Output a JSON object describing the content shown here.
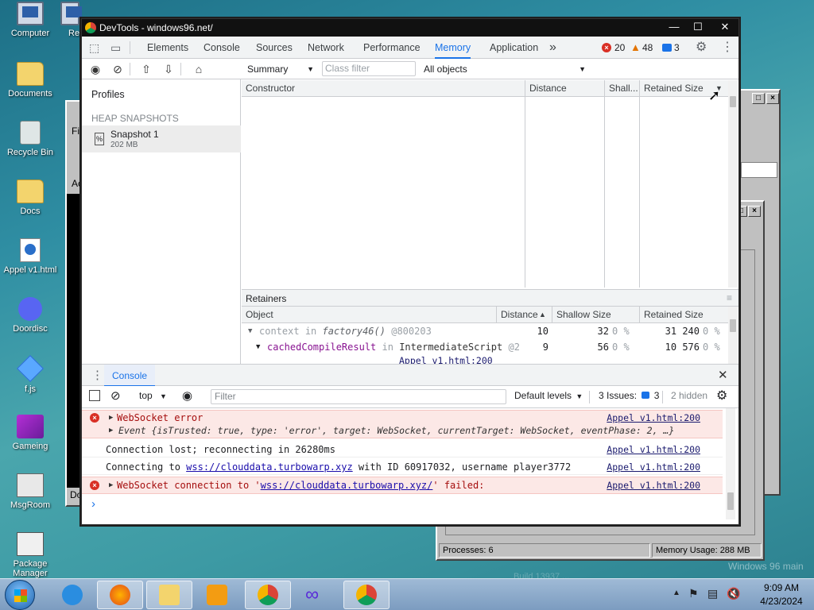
{
  "desktop": {
    "icons": [
      {
        "label": "Computer",
        "icon": "computer-icon"
      },
      {
        "label": "Re",
        "icon": "computer-icon"
      },
      {
        "label": "Documents",
        "icon": "folder-icon"
      },
      {
        "label": "Recycle Bin",
        "icon": "recycle-bin-icon"
      },
      {
        "label": "Docs",
        "icon": "folder-icon"
      },
      {
        "label": "Appel v1.html",
        "icon": "html-file-icon"
      },
      {
        "label": "Doordisc",
        "icon": "discord-icon"
      },
      {
        "label": "f.js",
        "icon": "diamond-icon"
      },
      {
        "label": "Gameing",
        "icon": "cube-icon"
      },
      {
        "label": "MsgRoom",
        "icon": "msgroom-icon"
      },
      {
        "label": "Package Manager",
        "icon": "package-icon"
      }
    ],
    "watermark": "Windows 96 main",
    "build_text": "Build 13937 ..."
  },
  "background_window": {
    "processes": "Processes: 6",
    "memory_usage": "Memory Usage: 288 MB",
    "fragments": [
      "Fi",
      "Ac",
      "Do"
    ]
  },
  "devtools": {
    "title": "DevTools - windows96.net/",
    "tabs": [
      {
        "label": "Elements"
      },
      {
        "label": "Console"
      },
      {
        "label": "Sources"
      },
      {
        "label": "Network"
      },
      {
        "label": "Performance"
      },
      {
        "label": "Memory"
      },
      {
        "label": "Application"
      }
    ],
    "more_tabs": "»",
    "error_count": "20",
    "warning_count": "48",
    "info_count": "3",
    "profiles_label": "Profiles",
    "heap_snapshots_label": "HEAP SNAPSHOTS",
    "snapshot": {
      "name": "Snapshot 1",
      "size": "202 MB"
    },
    "summary_select": "Summary",
    "class_filter_placeholder": "Class filter",
    "objects_select": "All objects",
    "columns": {
      "constructor": "Constructor",
      "distance": "Distance",
      "shallow": "Shall...",
      "retained": "Retained Size"
    },
    "retainers": {
      "title": "Retainers",
      "columns": {
        "object": "Object",
        "distance": "Distance",
        "shallow": "Shallow Size",
        "retained": "Retained Size"
      },
      "rows": [
        {
          "object_key": "context",
          "object_in": "in",
          "object_fn": "factory46()",
          "object_id": "@800203",
          "distance": "10",
          "shallow": "32",
          "shallow_pct": "0 %",
          "retained": "31 240",
          "retained_pct": "0 %"
        },
        {
          "object_key": "cachedCompileResult",
          "object_in": "in",
          "object_fn": "IntermediateScript",
          "object_id": "@2",
          "distance": "9",
          "shallow": "56",
          "shallow_pct": "0 %",
          "retained": "10 576",
          "retained_pct": "0 %"
        }
      ],
      "partial_link": "Appel v1.html:200"
    },
    "console": {
      "drawer_tab": "Console",
      "context": "top",
      "filter_placeholder": "Filter",
      "levels": "Default levels",
      "issues_label": "3 Issues:",
      "issues_count": "3",
      "hidden": "2 hidden",
      "messages": [
        {
          "type": "error",
          "text": "WebSocket error",
          "source": "Appel v1.html:200"
        },
        {
          "type": "error-detail",
          "text": "Event {isTrusted: true, type: 'error', target: WebSocket, currentTarget: WebSocket, eventPhase: 2, …}"
        },
        {
          "type": "log",
          "text": "Connection lost; reconnecting in 26280ms",
          "source": "Appel v1.html:200"
        },
        {
          "type": "log",
          "text_before": "Connecting to ",
          "link": "wss://clouddata.turbowarp.xyz",
          "text_after": " with ID 60917032, username player3772",
          "source": "Appel v1.html:200"
        },
        {
          "type": "error",
          "text_before": "WebSocket connection to '",
          "link": "wss://clouddata.turbowarp.xyz/",
          "text_after": "' failed:",
          "source": "Appel v1.html:200"
        }
      ],
      "prompt": "›"
    }
  },
  "taskbar": {
    "time": "9:09 AM",
    "date": "4/23/2024"
  },
  "colors": {
    "accent": "#1a73e8",
    "error": "#d93025",
    "warning": "#e37400"
  }
}
